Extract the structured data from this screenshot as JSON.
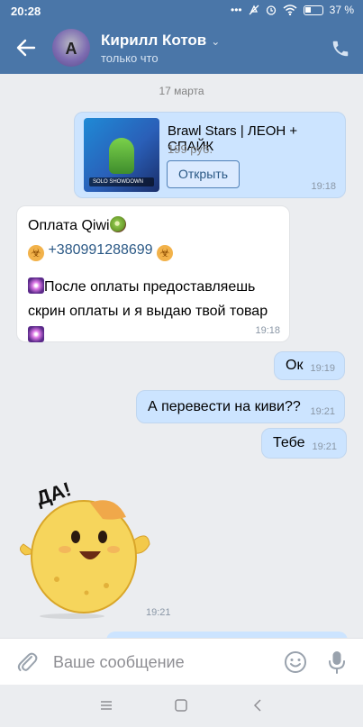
{
  "status_bar": {
    "time": "20:28",
    "battery": "37 %"
  },
  "header": {
    "name": "Кирилл Котов",
    "status": "только что",
    "avatar_letter": "A"
  },
  "chat": {
    "date_separator": "17 марта",
    "messages": [
      {
        "direction": "out",
        "type": "product",
        "title": "Brawl Stars | ЛЕОН + СПАЙК",
        "price": "199 руб.",
        "button": "Открыть",
        "thumb_caption": "SOLO SHOWDOWN",
        "time": "19:18"
      },
      {
        "direction": "in",
        "type": "text",
        "line1": "Оплата Qiwi",
        "phone": "+380991288699",
        "line3a": "После оплаты предоставляешь",
        "line3b": "скрин оплаты и я выдаю твой товар",
        "time": "19:18"
      },
      {
        "direction": "out",
        "type": "text",
        "text": "Ок",
        "time": "19:19"
      },
      {
        "direction": "out",
        "type": "text",
        "text": "А перевести на киви??",
        "time": "19:21"
      },
      {
        "direction": "out",
        "type": "text",
        "text": "Тебе",
        "time": "19:21"
      },
      {
        "direction": "in",
        "type": "sticker",
        "sticker_text": "ДА!",
        "time": "19:21"
      }
    ]
  },
  "composer": {
    "placeholder": "Ваше сообщение"
  },
  "icons": {
    "back": "arrow-left-icon",
    "phone": "phone-icon",
    "attach": "paperclip-icon",
    "emoji": "smile-icon",
    "voice": "microphone-icon",
    "nav_menu": "menu-icon",
    "nav_home": "square-icon",
    "nav_back": "chevron-left-icon"
  },
  "colors": {
    "header": "#4a76a8",
    "outgoing_bubble": "#cce4ff",
    "incoming_bubble": "#ffffff",
    "chat_background": "#ebedf0",
    "link": "#2a5885"
  }
}
